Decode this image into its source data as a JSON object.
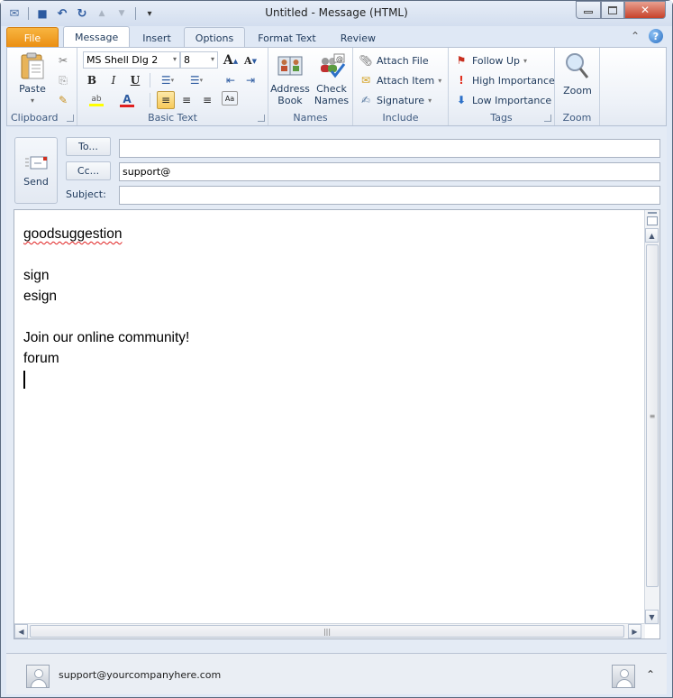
{
  "window": {
    "title": "Untitled  -  Message (HTML)",
    "controls": {
      "minimize": "—",
      "maximize": "▫",
      "close": "✕"
    }
  },
  "quick_access": {
    "items": [
      {
        "name": "mail-icon",
        "glyph": "✉"
      },
      {
        "name": "save-icon",
        "glyph": "💾"
      },
      {
        "name": "undo-icon",
        "glyph": "↶"
      },
      {
        "name": "redo-icon",
        "glyph": "↻"
      },
      {
        "name": "up-arrow-icon",
        "glyph": "▲"
      },
      {
        "name": "down-arrow-icon",
        "glyph": "▼"
      }
    ],
    "customize_glyph": "▾"
  },
  "tabs": [
    {
      "label": "File"
    },
    {
      "label": "Message"
    },
    {
      "label": "Insert"
    },
    {
      "label": "Options"
    },
    {
      "label": "Format Text"
    },
    {
      "label": "Review"
    }
  ],
  "help": {
    "collapse_glyph": "⌃",
    "help_glyph": "?"
  },
  "ribbon": {
    "clipboard": {
      "label": "Clipboard",
      "paste": "Paste",
      "paste_arrow": "▾",
      "cut_glyph": "✂",
      "copy_glyph": "⎘",
      "painter_glyph": "🖌"
    },
    "basic_text": {
      "label": "Basic Text",
      "font_name": "MS Shell Dlg 2",
      "font_size": "8",
      "combo_arrow": "▾",
      "grow_glyph": "A",
      "shrink_glyph": "A",
      "bold": "B",
      "italic": "I",
      "underline": "U",
      "bullets_glyph": "☰",
      "numbering_glyph": "☰",
      "decrease_indent_glyph": "⇤",
      "increase_indent_glyph": "⇥",
      "highlight_glyph": "ab",
      "font_color_glyph": "A",
      "align_left_glyph": "≡",
      "align_center_glyph": "≡",
      "align_right_glyph": "≡",
      "styles_glyph": "Aa",
      "highlight_color": "#ffff00",
      "font_color": "#e02020"
    },
    "names": {
      "label": "Names",
      "address_book": [
        "Address",
        "Book"
      ],
      "check_names": [
        "Check",
        "Names"
      ]
    },
    "include": {
      "label": "Include",
      "attach_file": "Attach File",
      "attach_item": "Attach Item",
      "signature": "Signature",
      "dropdown": "▾"
    },
    "tags": {
      "label": "Tags",
      "follow_up": "Follow Up",
      "high_importance": "High Importance",
      "low_importance": "Low Importance",
      "dropdown": "▾"
    },
    "zoom": {
      "label": "Zoom",
      "button": "Zoom"
    }
  },
  "compose": {
    "send": "Send",
    "to_button": "To...",
    "cc_button": "Cc...",
    "subject_label": "Subject:",
    "to_value": "",
    "cc_value": "support@",
    "subject_value": ""
  },
  "body": {
    "lines": [
      "goodsuggestion",
      "",
      "sign",
      "esign",
      "",
      "Join our online community!",
      "forum"
    ],
    "misspelled": "goodsuggestion"
  },
  "scrollbars": {
    "up": "▲",
    "down": "▼",
    "left": "◀",
    "right": "▶",
    "grip_v": "≡",
    "grip_h": "|||"
  },
  "people_pane": {
    "email": "support@yourcompanyhere.com",
    "expand_glyph": "⌃"
  },
  "colors": {
    "file_tab": "#ea8d11",
    "accent": "#1e395b",
    "selected_button": "#f7c95a"
  }
}
